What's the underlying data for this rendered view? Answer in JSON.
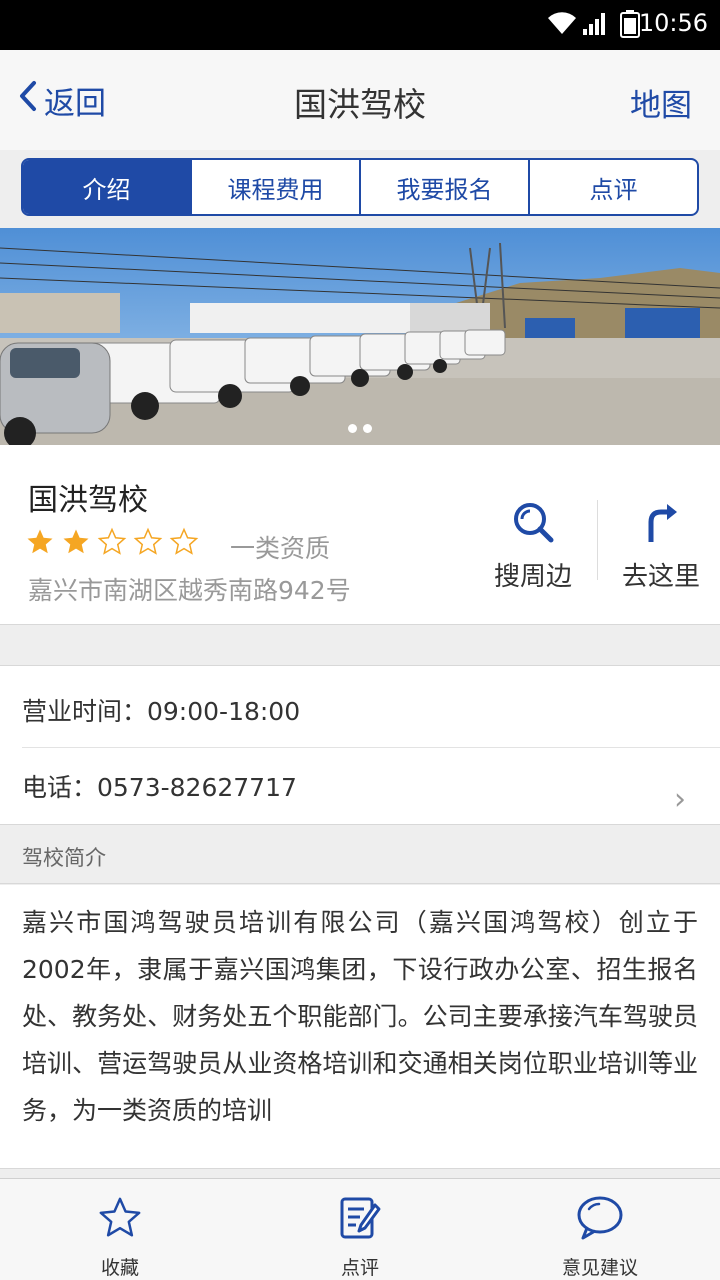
{
  "status_bar": {
    "time": "10:56",
    "icons": [
      "wifi-icon",
      "signal-icon",
      "battery-icon"
    ]
  },
  "nav": {
    "back_label": "返回",
    "title": "国洪驾校",
    "map_label": "地图"
  },
  "tabs": [
    {
      "label": "介绍",
      "active": true
    },
    {
      "label": "课程费用",
      "active": false
    },
    {
      "label": "我要报名",
      "active": false
    },
    {
      "label": "点评",
      "active": false
    }
  ],
  "banner": {
    "page_count": 2,
    "current_page": 1
  },
  "school": {
    "name": "国洪驾校",
    "rating": 2,
    "rating_max": 5,
    "qualification": "一类资质",
    "address": "嘉兴市南湖区越秀南路942号"
  },
  "actions": {
    "search_nearby": "搜周边",
    "go_here": "去这里"
  },
  "details": {
    "hours": "营业时间：09:00-18:00",
    "phone": "电话：0573-82627717"
  },
  "intro": {
    "header": "驾校简介",
    "text": "嘉兴市国鸿驾驶员培训有限公司（嘉兴国鸿驾校）创立于2002年，隶属于嘉兴国鸿集团，下设行政办公室、招生报名处、教务处、财务处五个职能部门。公司主要承接汽车驾驶员培训、营运驾驶员从业资格培训和交通相关岗位职业培训等业务，为一类资质的培训"
  },
  "bottom_bar": [
    {
      "label": "收藏",
      "icon": "star-icon"
    },
    {
      "label": "点评",
      "icon": "edit-icon"
    },
    {
      "label": "意见建议",
      "icon": "chat-bubble-icon"
    }
  ],
  "colors": {
    "accent": "#1f4aa6",
    "star": "#f5a623",
    "muted_text": "#999999"
  }
}
